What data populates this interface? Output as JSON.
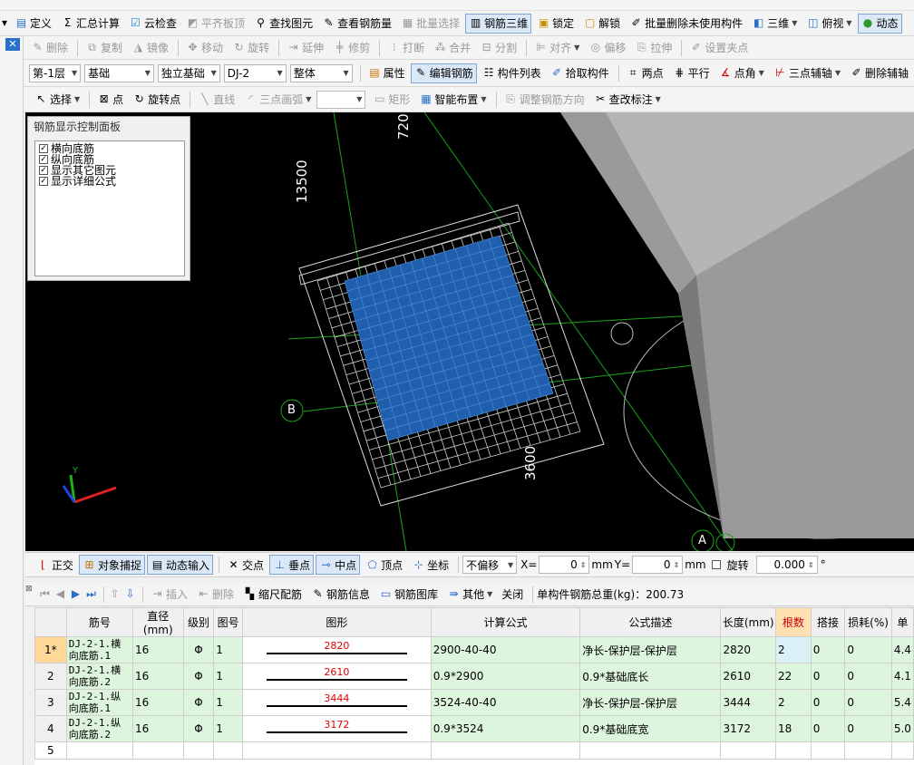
{
  "toolbar1": {
    "items": [
      {
        "label": "定义",
        "icon": "define-icon"
      },
      {
        "label": "汇总计算",
        "icon": "sum-icon"
      },
      {
        "label": "云检查",
        "icon": "cloud-check-icon"
      },
      {
        "label": "平齐板顶",
        "icon": "align-slab-icon"
      },
      {
        "label": "查找图元",
        "icon": "binoculars-icon"
      },
      {
        "label": "查看钢筋量",
        "icon": "view-rebar-icon"
      },
      {
        "label": "批量选择",
        "icon": "batch-select-icon"
      },
      {
        "label": "钢筋三维",
        "icon": "rebar-3d-icon"
      },
      {
        "label": "锁定",
        "icon": "lock-icon"
      },
      {
        "label": "解锁",
        "icon": "unlock-icon"
      },
      {
        "label": "批量删除未使用构件",
        "icon": "batch-delete-icon"
      },
      {
        "label": "三维",
        "icon": "cube-icon"
      },
      {
        "label": "俯视",
        "icon": "top-view-icon"
      },
      {
        "label": "动态",
        "icon": "dynamic-icon"
      }
    ]
  },
  "toolbar2": {
    "items": [
      "删除",
      "复制",
      "镜像",
      "移动",
      "旋转",
      "延伸",
      "修剪",
      "打断",
      "合并",
      "分割",
      "对齐",
      "偏移",
      "拉伸",
      "设置夹点"
    ]
  },
  "toolbar3": {
    "floor": "第-1层",
    "category": "基础",
    "type": "独立基础",
    "component": "DJ-2",
    "scope": "整体",
    "attr": "属性",
    "edit_rebar": "编辑钢筋",
    "list": "构件列表",
    "pick": "拾取构件",
    "twopoint": "两点",
    "parallel": "平行",
    "pointangle": "点角",
    "threepoint": "三点辅轴",
    "delaux": "删除辅轴"
  },
  "toolbar4": {
    "select": "选择",
    "point": "点",
    "rotate_point": "旋转点",
    "line": "直线",
    "arc": "三点画弧",
    "rect": "矩形",
    "smart": "智能布置",
    "adjust_dir": "调整钢筋方向",
    "check_mark": "查改标注"
  },
  "panel": {
    "title": "钢筋显示控制面板",
    "options": [
      "横向底筋",
      "纵向底筋",
      "显示其它图元",
      "显示详细公式"
    ]
  },
  "viewport": {
    "dim_13500": "13500",
    "dim_720": "720",
    "dim_3600": "3600",
    "axis_b": "B",
    "axis_a": "A",
    "axis_y": "Y"
  },
  "snapbar": {
    "ortho": "正交",
    "snap": "对象捕捉",
    "dyn": "动态输入",
    "intersect": "交点",
    "perp": "垂点",
    "mid": "中点",
    "vertex": "顶点",
    "coord": "坐标",
    "offset": "不偏移",
    "x_label": "X=",
    "x_val": "0",
    "y_label": "Y=",
    "y_val": "0",
    "unit": "mm",
    "rotate": "旋转",
    "rotate_val": "0.000",
    "deg": "°"
  },
  "gridbar": {
    "insert": "插入",
    "delete": "删除",
    "scale": "缩尺配筋",
    "info": "钢筋信息",
    "lib": "钢筋图库",
    "other": "其他",
    "close": "关闭",
    "total": "单构件钢筋总重(kg)：200.73"
  },
  "table": {
    "headers": [
      "筋号",
      "直径(mm)",
      "级别",
      "图号",
      "图形",
      "计算公式",
      "公式描述",
      "长度(mm)",
      "根数",
      "搭接",
      "损耗(%)",
      "单"
    ],
    "rows": [
      {
        "idx": "1*",
        "name": "DJ-2-1.横向底筋.1",
        "dia": "16",
        "grade": "Φ",
        "fig": "1",
        "shape": "2820",
        "formula": "2900-40-40",
        "desc": "净长-保护层-保护层",
        "len": "2820",
        "count": "2",
        "lap": "0",
        "loss": "0",
        "unit": "4.4"
      },
      {
        "idx": "2",
        "name": "DJ-2-1.横向底筋.2",
        "dia": "16",
        "grade": "Φ",
        "fig": "1",
        "shape": "2610",
        "formula": "0.9*2900",
        "desc": "0.9*基础底长",
        "len": "2610",
        "count": "22",
        "lap": "0",
        "loss": "0",
        "unit": "4.1"
      },
      {
        "idx": "3",
        "name": "DJ-2-1.纵向底筋.1",
        "dia": "16",
        "grade": "Φ",
        "fig": "1",
        "shape": "3444",
        "formula": "3524-40-40",
        "desc": "净长-保护层-保护层",
        "len": "3444",
        "count": "2",
        "lap": "0",
        "loss": "0",
        "unit": "5.4"
      },
      {
        "idx": "4",
        "name": "DJ-2-1.纵向底筋.2",
        "dia": "16",
        "grade": "Φ",
        "fig": "1",
        "shape": "3172",
        "formula": "0.9*3524",
        "desc": "0.9*基础底宽",
        "len": "3172",
        "count": "18",
        "lap": "0",
        "loss": "0",
        "unit": "5.0"
      }
    ],
    "empty_idx": "5"
  }
}
